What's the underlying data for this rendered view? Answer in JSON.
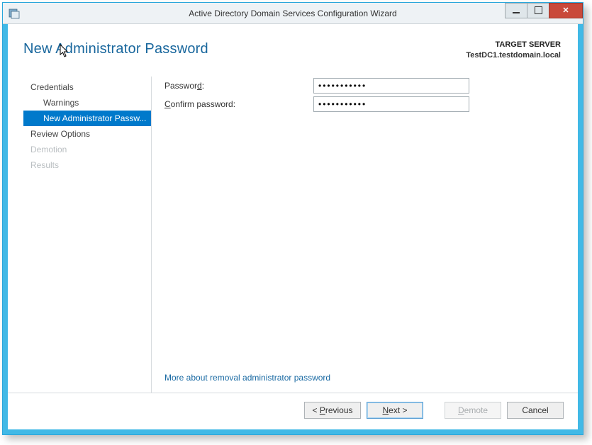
{
  "window": {
    "title": "Active Directory Domain Services Configuration Wizard"
  },
  "header": {
    "page_title": "New Administrator Password",
    "target_label": "TARGET SERVER",
    "target_server": "TestDC1.testdomain.local"
  },
  "nav": {
    "items": [
      {
        "label": "Credentials",
        "sub": false,
        "selected": false,
        "disabled": false
      },
      {
        "label": "Warnings",
        "sub": true,
        "selected": false,
        "disabled": false
      },
      {
        "label": "New Administrator Passw...",
        "sub": true,
        "selected": true,
        "disabled": false
      },
      {
        "label": "Review Options",
        "sub": false,
        "selected": false,
        "disabled": false
      },
      {
        "label": "Demotion",
        "sub": false,
        "selected": false,
        "disabled": true
      },
      {
        "label": "Results",
        "sub": false,
        "selected": false,
        "disabled": true
      }
    ]
  },
  "form": {
    "password_label_pre": "Passwor",
    "password_label_ul": "d",
    "password_label_post": ":",
    "confirm_label_pre": "",
    "confirm_label_ul": "C",
    "confirm_label_post": "onfirm password:",
    "password_value": "●●●●●●●●●●●",
    "confirm_value": "●●●●●●●●●●●"
  },
  "help": {
    "link_text": "More about removal administrator password"
  },
  "footer": {
    "previous_pre": "< ",
    "previous_ul": "P",
    "previous_post": "revious",
    "next_pre": "",
    "next_ul": "N",
    "next_post": "ext >",
    "demote_pre": "",
    "demote_ul": "D",
    "demote_post": "emote",
    "cancel": "Cancel"
  }
}
